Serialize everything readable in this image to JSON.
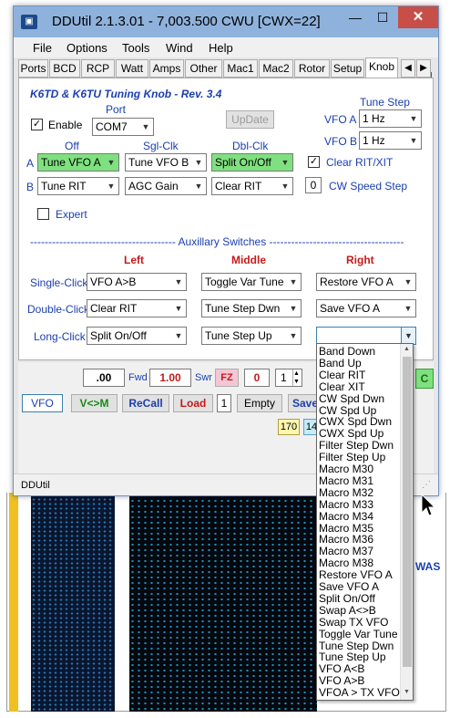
{
  "window": {
    "icon": "radio-app-icon",
    "title": "DDUtil 2.1.3.01 - 7,003.500   CWU   [CWX=22]",
    "minimize": "—",
    "maximize": "☐",
    "close": "✕"
  },
  "menu": [
    "File",
    "Options",
    "Tools",
    "Wind",
    "Help"
  ],
  "tabs": [
    "Ports",
    "BCD",
    "RCP",
    "Watt",
    "Amps",
    "Other",
    "Mac1",
    "Mac2",
    "Rotor",
    "Setup",
    "Knob"
  ],
  "knob": {
    "title": "K6TD & K6TU Tuning Knob - Rev. 3.4",
    "enable_label": "Enable",
    "enable_checked": true,
    "port_label": "Port",
    "port_value": "COM7",
    "update_button": "UpDate",
    "tune_step_label": "Tune Step",
    "vfo_a_label": "VFO A",
    "vfo_a_step": "1 Hz",
    "vfo_b_label": "VFO B",
    "vfo_b_step": "1 Hz",
    "col_off": "Off",
    "col_sgl": "Sgl-Clk",
    "col_dbl": "Dbl-Clk",
    "row_a": "A",
    "row_b": "B",
    "a_off": "Tune VFO A",
    "a_sgl": "Tune VFO B",
    "a_dbl": "Split On/Off",
    "b_off": "Tune RIT",
    "b_sgl": "AGC Gain",
    "b_dbl": "Clear RIT",
    "clear_rit_label": "Clear RIT/XIT",
    "clear_rit_checked": true,
    "cw_speed_value": "0",
    "cw_speed_label": "CW Speed Step",
    "expert_label": "Expert",
    "expert_checked": false,
    "aux_header": "----------------------------------------    Auxillary Switches    -------------------------------------",
    "col_left": "Left",
    "col_middle": "Middle",
    "col_right": "Right",
    "single_label": "Single-Click",
    "double_label": "Double-Click",
    "long_label": "Long-Click",
    "single_left": "VFO A>B",
    "single_middle": "Toggle Var Tune",
    "single_right": "Restore VFO A",
    "double_left": "Clear RIT",
    "double_middle": "Tune Step Dwn",
    "double_right": "Save VFO A",
    "long_left": "Split On/Off",
    "long_middle": "Tune Step Up",
    "long_right": ""
  },
  "lower": {
    "fwd_value": ".00",
    "fwd_label": "Fwd",
    "swr_value": "1.00",
    "swr_label": "Swr",
    "fz_label": "FZ",
    "fz_value": "0",
    "stepper_value": "1",
    "vfo_button": "VFO",
    "vm_button": "V<>M",
    "recall_button": "ReCall",
    "load_button": "Load",
    "mem_value": "1",
    "empty_button": "Empty",
    "save_button": "Save",
    "badge1": "170",
    "badge2": "14",
    "green_label": "C"
  },
  "status": "DDUtil",
  "dropdown": [
    "Band Down",
    "Band Up",
    "Clear RIT",
    "Clear XIT",
    "CW Spd Dwn",
    "CW Spd Up",
    "CWX Spd Dwn",
    "CWX Spd Up",
    "Filter Step Dwn",
    "Filter Step Up",
    "Macro M30",
    "Macro M31",
    "Macro M32",
    "Macro M33",
    "Macro M34",
    "Macro M35",
    "Macro M36",
    "Macro M37",
    "Macro M38",
    "Restore VFO A",
    "Save VFO A",
    "Split On/Off",
    "Swap A<>B",
    "Swap TX VFO",
    "Toggle Var Tune",
    "Tune Step Dwn",
    "Tune Step Up",
    "VFO A<B",
    "VFO A>B",
    "VFOA > TX VFO"
  ],
  "background": {
    "side_text": "WAS"
  },
  "colors": {
    "title": "#1a3fb0",
    "header_red": "#c41a1a",
    "highlight_green": "#7fe07f",
    "close_red": "#c74f48"
  }
}
